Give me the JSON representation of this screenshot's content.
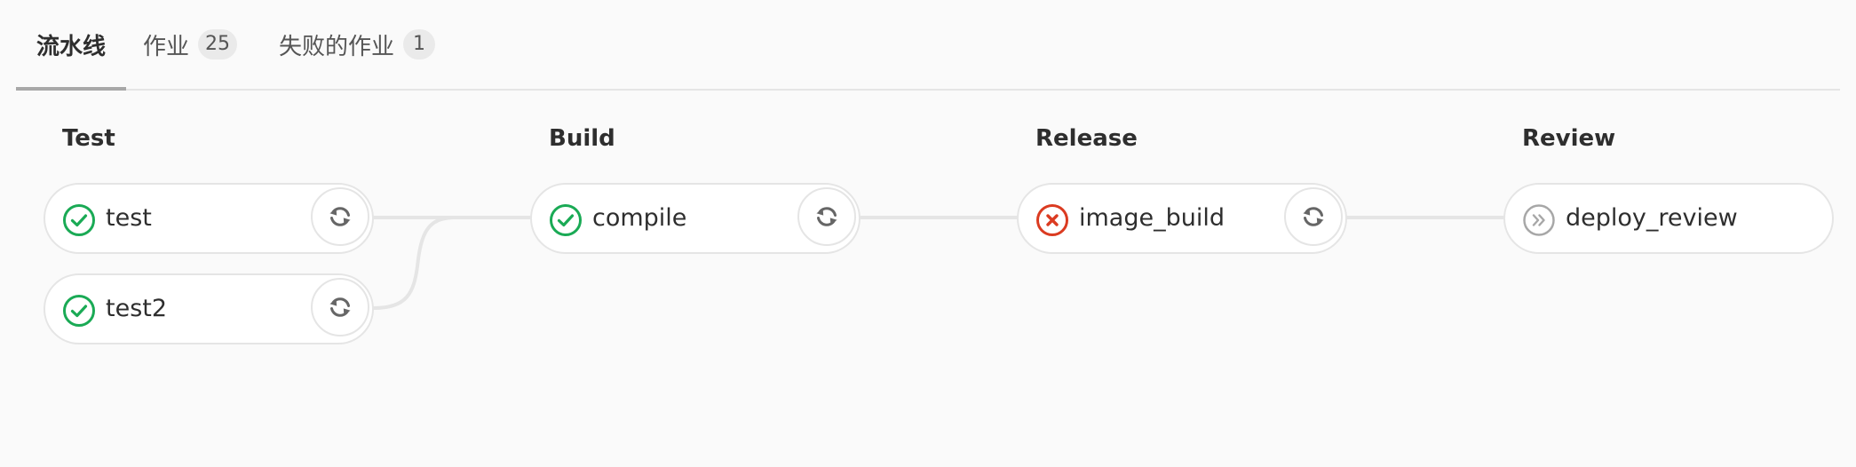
{
  "tabs": {
    "pipeline": {
      "label": "流水线"
    },
    "jobs": {
      "label": "作业",
      "count": "25"
    },
    "failed_jobs": {
      "label": "失败的作业",
      "count": "1"
    }
  },
  "stages": [
    {
      "name": "Test"
    },
    {
      "name": "Build"
    },
    {
      "name": "Release"
    },
    {
      "name": "Review"
    }
  ],
  "jobs": {
    "test": {
      "name": "test",
      "status": "success",
      "action": "retry"
    },
    "test2": {
      "name": "test2",
      "status": "success",
      "action": "retry"
    },
    "compile": {
      "name": "compile",
      "status": "success",
      "action": "retry"
    },
    "image_build": {
      "name": "image_build",
      "status": "failed",
      "action": "retry"
    },
    "deploy_review": {
      "name": "deploy_review",
      "status": "skipped",
      "action": ""
    }
  },
  "colors": {
    "success": "#1aaa55",
    "failed": "#db3b21",
    "skipped": "#a7a7a7",
    "connector": "#e5e5e5"
  },
  "icons": {
    "success": "status-success-icon",
    "failed": "status-failed-icon",
    "skipped": "status-skipped-icon",
    "retry": "retry-icon"
  }
}
